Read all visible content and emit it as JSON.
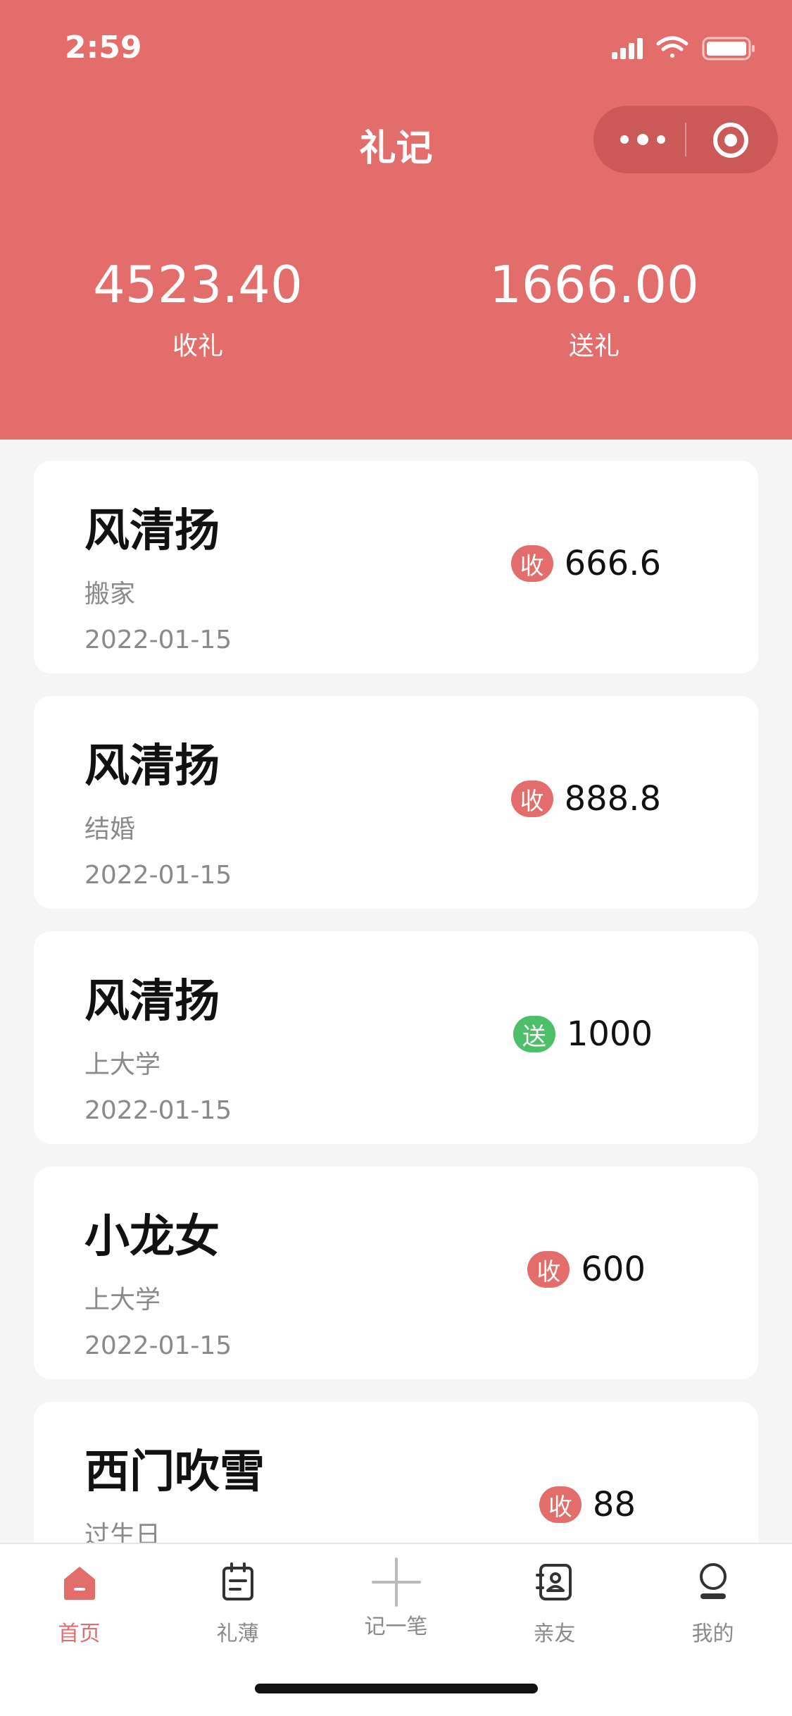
{
  "status_bar": {
    "time": "2:59"
  },
  "nav": {
    "title": "礼记"
  },
  "summary": {
    "received_value": "4523.40",
    "received_label": "收礼",
    "given_value": "1666.00",
    "given_label": "送礼"
  },
  "records": [
    {
      "name": "风清扬",
      "event": "搬家",
      "date": "2022-01-15",
      "type": "收",
      "type_kind": "recv",
      "amount": "666.6"
    },
    {
      "name": "风清扬",
      "event": "结婚",
      "date": "2022-01-15",
      "type": "收",
      "type_kind": "recv",
      "amount": "888.8"
    },
    {
      "name": "风清扬",
      "event": "上大学",
      "date": "2022-01-15",
      "type": "送",
      "type_kind": "give",
      "amount": "1000"
    },
    {
      "name": "小龙女",
      "event": "上大学",
      "date": "2022-01-15",
      "type": "收",
      "type_kind": "recv",
      "amount": "600"
    },
    {
      "name": "西门吹雪",
      "event": "过生日",
      "date": "",
      "type": "收",
      "type_kind": "recv",
      "amount": "88"
    }
  ],
  "tabbar": {
    "items": [
      {
        "label": "首页",
        "icon": "home-icon",
        "active": true
      },
      {
        "label": "礼薄",
        "icon": "notebook-icon",
        "active": false
      },
      {
        "label": "记一笔",
        "icon": "plus-icon",
        "active": false
      },
      {
        "label": "亲友",
        "icon": "contacts-icon",
        "active": false
      },
      {
        "label": "我的",
        "icon": "profile-icon",
        "active": false
      }
    ]
  },
  "colors": {
    "accent": "#e36d6a",
    "receive": "#e36d6a",
    "give": "#4dbf69",
    "background": "#f5f5f5"
  }
}
